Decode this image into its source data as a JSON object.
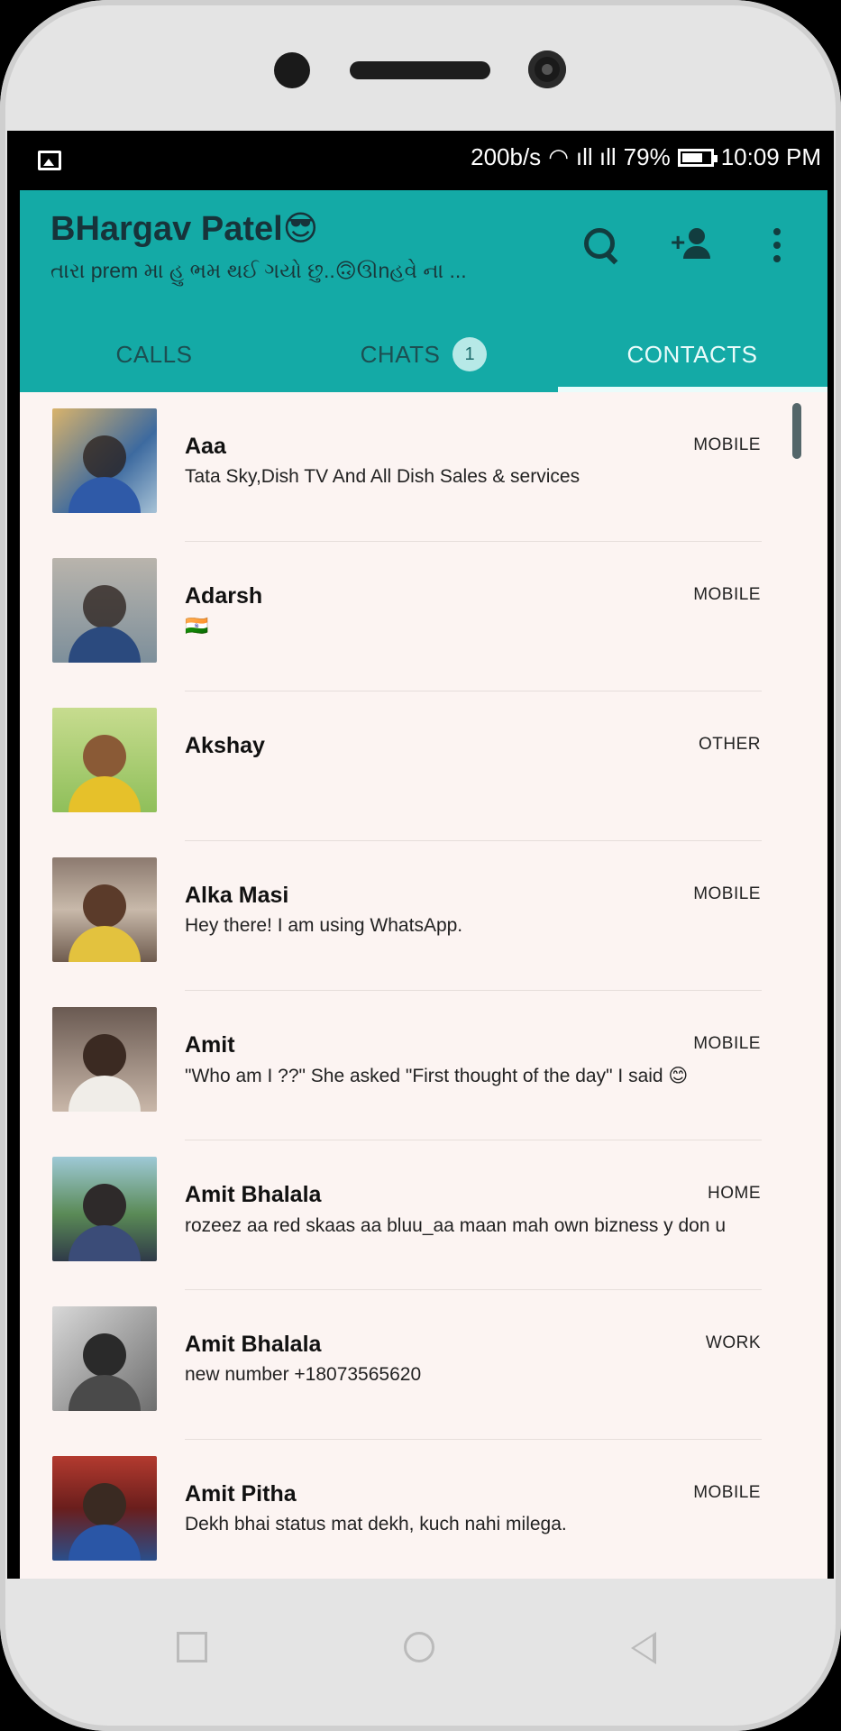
{
  "statusbar": {
    "speed": "200b/s",
    "battery": "79%",
    "time": "10:09 PM"
  },
  "header": {
    "title": "BHargav Patel😎",
    "subtitle": "તારા prem મા હુ ભમ થઈ ગયો છુ..🙃ઊnહવે ના ..."
  },
  "tabs": [
    {
      "label": "CALLS"
    },
    {
      "label": "CHATS",
      "badge": "1"
    },
    {
      "label": "CONTACTS"
    }
  ],
  "contacts": [
    {
      "name": "Aaa",
      "status": "Tata Sky,Dish TV And All Dish Sales & services",
      "type": "MOBILE"
    },
    {
      "name": "Adarsh",
      "status": "🇮🇳",
      "type": "MOBILE"
    },
    {
      "name": "Akshay",
      "status": "",
      "type": "OTHER"
    },
    {
      "name": "Alka Masi",
      "status": "Hey there! I am using WhatsApp.",
      "type": "MOBILE"
    },
    {
      "name": "Amit",
      "status": "\"Who am I ??\"  She asked  \"First thought of the day\" I said 😊",
      "type": "MOBILE"
    },
    {
      "name": "Amit Bhalala",
      "status": "rozeez aa red skaas aa bluu_aa maan mah own bizness y don u😏",
      "type": "HOME"
    },
    {
      "name": "Amit Bhalala",
      "status": "new number +18073565620",
      "type": "WORK"
    },
    {
      "name": "Amit Pitha",
      "status": "Dekh bhai status mat dekh, kuch nahi milega.",
      "type": "MOBILE"
    }
  ],
  "colors": {
    "accent": "#14aaa6",
    "list_background": "#fcf4f2"
  }
}
